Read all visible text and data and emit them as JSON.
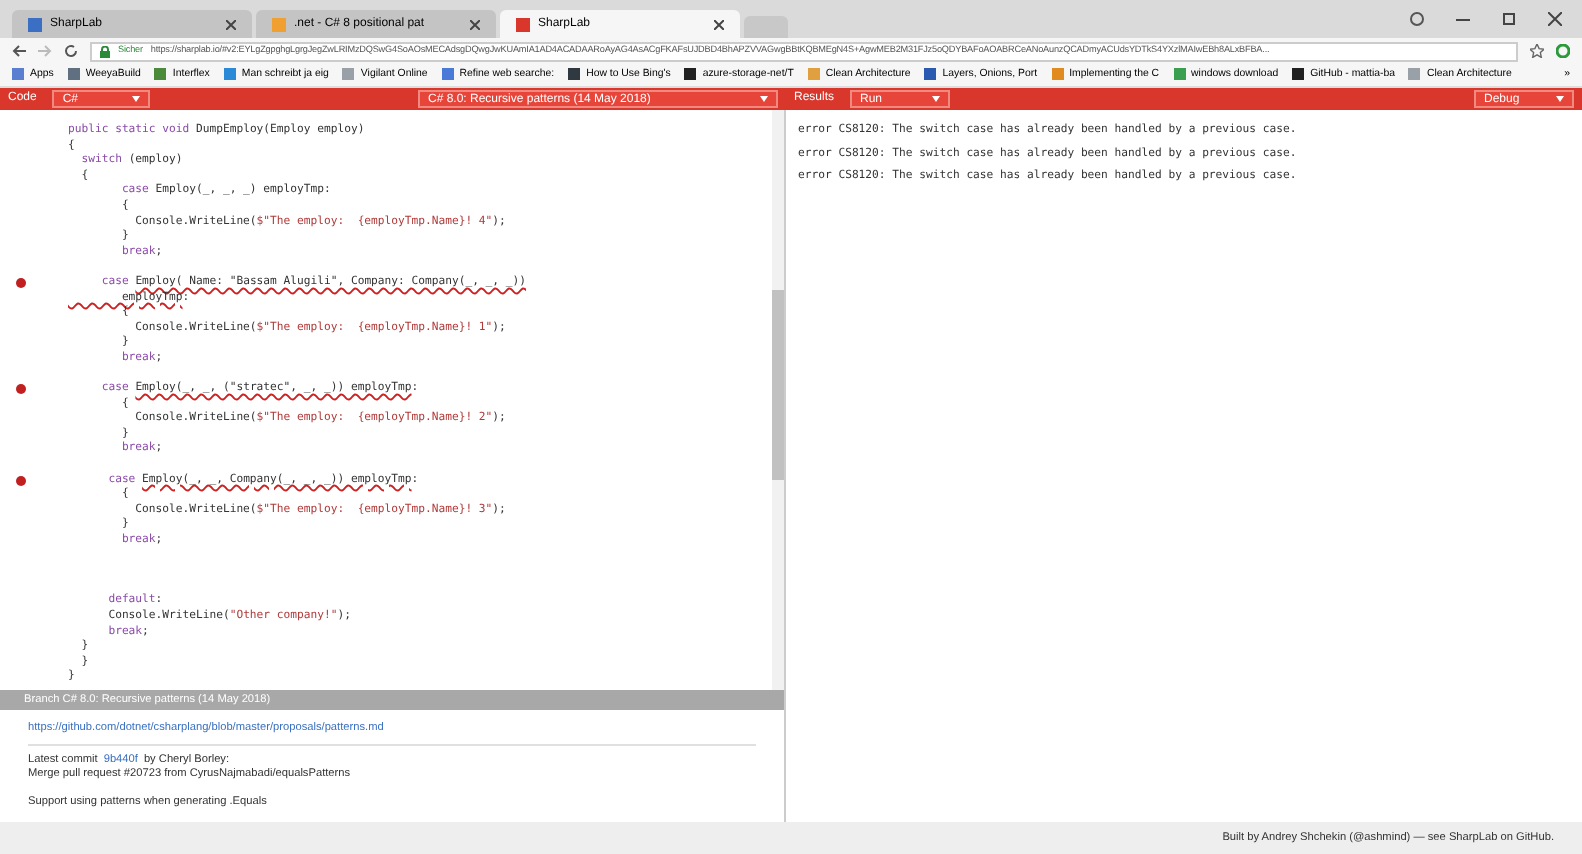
{
  "browser": {
    "tabs": [
      {
        "title": "SharpLab",
        "selected": false,
        "color": "#3b6fc4"
      },
      {
        "title": ".net - C# 8 positional pat",
        "selected": false,
        "color": "#f0a030"
      },
      {
        "title": "SharpLab",
        "selected": true,
        "color": "#d9372b"
      }
    ],
    "address": {
      "secure_label": "Sicher",
      "url": "https://sharplab.io/#v2:EYLgZgpghgLgrgJegZwLRIMzDQSwG4SoAOsMECAdsgDQwgJwKUAmIA1AD4ACADAARoAyAG4AsACgFKAFsUJDBD4BhAPZVVAGwgBBtKQBMEgN4S+AgwMEB2M31FJz5oQDYBAFoAOABRCeANoAunzQCADmyACUdsYDTkS4YXzlMAIwEBh8ALxBFBA..."
    },
    "bookmarks": [
      {
        "title": "Apps",
        "color": "#5a7fd0"
      },
      {
        "title": "WeeyaBuild",
        "color": "#607080"
      },
      {
        "title": "Interflex",
        "color": "#4a8a3a"
      },
      {
        "title": "Man schreibt ja eig",
        "color": "#2a8ad8"
      },
      {
        "title": "Vigilant Online",
        "color": "#9aa0a8"
      },
      {
        "title": "Refine web searche:",
        "color": "#4a7ad8"
      },
      {
        "title": "How to Use Bing's",
        "color": "#303840"
      },
      {
        "title": "azure-storage-net/T",
        "color": "#202020"
      },
      {
        "title": "Clean Architecture",
        "color": "#e0a040"
      },
      {
        "title": "Layers, Onions, Port",
        "color": "#2a5ab0"
      },
      {
        "title": "Implementing the C",
        "color": "#e08a20"
      },
      {
        "title": "windows download",
        "color": "#3aa050"
      },
      {
        "title": "GitHub - mattia-ba",
        "color": "#202020"
      },
      {
        "title": "Clean Architecture",
        "color": "#9aa0a8"
      }
    ],
    "bookmarks_more": "»"
  },
  "toolbar": {
    "code_label": "Code",
    "language": "C#",
    "branch": "C# 8.0: Recursive patterns (14 May 2018)",
    "results_label": "Results",
    "mode": "Run",
    "build": "Debug"
  },
  "editor": {
    "lines": [
      {
        "kind": "code",
        "error": false,
        "segments": [
          {
            "kind": "kw",
            "text": "public static void "
          },
          {
            "kind": "text",
            "text": "DumpEmploy(Employ employ)"
          }
        ]
      },
      {
        "kind": "code",
        "error": false,
        "segments": [
          {
            "kind": "text",
            "text": "{"
          }
        ]
      },
      {
        "kind": "code",
        "error": false,
        "segments": [
          {
            "kind": "kw",
            "text": "  switch "
          },
          {
            "kind": "text",
            "text": "(employ)"
          }
        ]
      },
      {
        "kind": "code",
        "error": false,
        "segments": [
          {
            "kind": "text",
            "text": "  {"
          }
        ]
      },
      {
        "kind": "code",
        "error": false,
        "segments": [
          {
            "kind": "kw",
            "text": "        case "
          },
          {
            "kind": "text",
            "text": "Employ(_, _, _) employTmp:"
          }
        ]
      },
      {
        "kind": "code",
        "error": false,
        "segments": [
          {
            "kind": "text",
            "text": "        {"
          }
        ]
      },
      {
        "kind": "code",
        "error": false,
        "segments": [
          {
            "kind": "text",
            "text": "          Console.WriteLine("
          },
          {
            "kind": "str",
            "text": "$\"The employ:  {employTmp.Name}! 4\""
          },
          {
            "kind": "text",
            "text": ");"
          }
        ]
      },
      {
        "kind": "code",
        "error": false,
        "segments": [
          {
            "kind": "text",
            "text": "        }"
          }
        ]
      },
      {
        "kind": "code",
        "error": false,
        "segments": [
          {
            "kind": "kw",
            "text": "        break"
          },
          {
            "kind": "text",
            "text": ";"
          }
        ]
      },
      {
        "kind": "blank"
      },
      {
        "kind": "code",
        "error": true,
        "segments": [
          {
            "kind": "kw",
            "text": "     case "
          },
          {
            "kind": "err",
            "text": "Employ( Name: \"Bassam Alugili\", Company: Company(_, _, _))"
          }
        ]
      },
      {
        "kind": "code",
        "error": false,
        "segments": [
          {
            "kind": "err",
            "text": "        employTmp"
          },
          {
            "kind": "text",
            "text": ":"
          }
        ]
      },
      {
        "kind": "code",
        "error": false,
        "segments": [
          {
            "kind": "text",
            "text": "        {"
          }
        ]
      },
      {
        "kind": "code",
        "error": false,
        "segments": [
          {
            "kind": "text",
            "text": "          Console.WriteLine("
          },
          {
            "kind": "str",
            "text": "$\"The employ:  {employTmp.Name}! 1\""
          },
          {
            "kind": "text",
            "text": ");"
          }
        ]
      },
      {
        "kind": "code",
        "error": false,
        "segments": [
          {
            "kind": "text",
            "text": "        }"
          }
        ]
      },
      {
        "kind": "code",
        "error": false,
        "segments": [
          {
            "kind": "kw",
            "text": "        break"
          },
          {
            "kind": "text",
            "text": ";"
          }
        ]
      },
      {
        "kind": "blank"
      },
      {
        "kind": "code",
        "error": true,
        "segments": [
          {
            "kind": "kw",
            "text": "     case "
          },
          {
            "kind": "err",
            "text": "Employ(_, _, (\"stratec\", _, _)) employTmp"
          },
          {
            "kind": "text",
            "text": ":"
          }
        ]
      },
      {
        "kind": "code",
        "error": false,
        "segments": [
          {
            "kind": "text",
            "text": "        {"
          }
        ]
      },
      {
        "kind": "code",
        "error": false,
        "segments": [
          {
            "kind": "text",
            "text": "          Console.WriteLine("
          },
          {
            "kind": "str",
            "text": "$\"The employ:  {employTmp.Name}! 2\""
          },
          {
            "kind": "text",
            "text": ");"
          }
        ]
      },
      {
        "kind": "code",
        "error": false,
        "segments": [
          {
            "kind": "text",
            "text": "        }"
          }
        ]
      },
      {
        "kind": "code",
        "error": false,
        "segments": [
          {
            "kind": "kw",
            "text": "        break"
          },
          {
            "kind": "text",
            "text": ";"
          }
        ]
      },
      {
        "kind": "blank"
      },
      {
        "kind": "code",
        "error": true,
        "segments": [
          {
            "kind": "kw",
            "text": "      case "
          },
          {
            "kind": "err",
            "text": "Employ(_, _, Company(_, _, _)) employTmp"
          },
          {
            "kind": "text",
            "text": ":"
          }
        ]
      },
      {
        "kind": "code",
        "error": false,
        "segments": [
          {
            "kind": "text",
            "text": "        {"
          }
        ]
      },
      {
        "kind": "code",
        "error": false,
        "segments": [
          {
            "kind": "text",
            "text": "          Console.WriteLine("
          },
          {
            "kind": "str",
            "text": "$\"The employ:  {employTmp.Name}! 3\""
          },
          {
            "kind": "text",
            "text": ");"
          }
        ]
      },
      {
        "kind": "code",
        "error": false,
        "segments": [
          {
            "kind": "text",
            "text": "        }"
          }
        ]
      },
      {
        "kind": "code",
        "error": false,
        "segments": [
          {
            "kind": "kw",
            "text": "        break"
          },
          {
            "kind": "text",
            "text": ";"
          }
        ]
      },
      {
        "kind": "blank"
      },
      {
        "kind": "blank"
      },
      {
        "kind": "blank"
      },
      {
        "kind": "code",
        "error": false,
        "segments": [
          {
            "kind": "kw",
            "text": "      default"
          },
          {
            "kind": "text",
            "text": ":"
          }
        ]
      },
      {
        "kind": "code",
        "error": false,
        "segments": [
          {
            "kind": "text",
            "text": "      Console.WriteLine("
          },
          {
            "kind": "str",
            "text": "\"Other company!\""
          },
          {
            "kind": "text",
            "text": ");"
          }
        ]
      },
      {
        "kind": "code",
        "error": false,
        "segments": [
          {
            "kind": "kw",
            "text": "      break"
          },
          {
            "kind": "text",
            "text": ";"
          }
        ]
      },
      {
        "kind": "code",
        "error": false,
        "segments": [
          {
            "kind": "text",
            "text": "  }"
          }
        ]
      },
      {
        "kind": "code",
        "error": false,
        "segments": [
          {
            "kind": "text",
            "text": "  }"
          }
        ]
      },
      {
        "kind": "code",
        "error": false,
        "segments": [
          {
            "kind": "text",
            "text": "}"
          }
        ]
      }
    ]
  },
  "branch": {
    "title": "Branch C# 8.0: Recursive patterns (14 May 2018)",
    "link": "https://github.com/dotnet/csharplang/blob/master/proposals/patterns.md",
    "commit_prefix": "Latest commit",
    "commit_hash": "9b440f",
    "commit_author": "by Cheryl Borley:",
    "commit_message": "Merge pull request #20723 from CyrusNajmabadi/equalsPatterns",
    "commit_detail": "Support using patterns when generating .Equals"
  },
  "results": [
    "error CS8120: The switch case has already been handled by a previous case.",
    "error CS8120: The switch case has already been handled by a previous case.",
    "error CS8120: The switch case has already been handled by a previous case."
  ],
  "footer": "Built by Andrey Shchekin (@ashmind) — see SharpLab on GitHub."
}
